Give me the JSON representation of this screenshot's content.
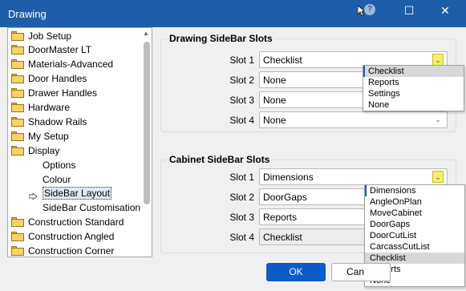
{
  "window": {
    "title": "Drawing",
    "help_glyph": "?",
    "maximize_glyph": "☐",
    "close_glyph": "✕"
  },
  "tree": {
    "items": [
      {
        "label": "Job Setup",
        "folder": true
      },
      {
        "label": "DoorMaster LT",
        "folder": true
      },
      {
        "label": "Materials-Advanced",
        "folder": true
      },
      {
        "label": "Door Handles",
        "folder": true
      },
      {
        "label": "Drawer Handles",
        "folder": true
      },
      {
        "label": "Hardware",
        "folder": true
      },
      {
        "label": "Shadow Rails",
        "folder": true
      },
      {
        "label": "My Setup",
        "folder": true
      },
      {
        "label": "Display",
        "folder": true
      },
      {
        "label": "Options",
        "folder": false
      },
      {
        "label": "Colour",
        "folder": false
      },
      {
        "label": "SideBar Layout",
        "folder": false,
        "selected": true
      },
      {
        "label": "SideBar Customisation",
        "folder": false
      },
      {
        "label": "Construction Standard",
        "folder": true
      },
      {
        "label": "Construction Angled",
        "folder": true
      },
      {
        "label": "Construction Corner",
        "folder": true
      }
    ]
  },
  "drawing_group": {
    "title": "Drawing SideBar Slots",
    "slots": [
      {
        "label": "Slot 1",
        "value": "Checklist"
      },
      {
        "label": "Slot 2",
        "value": "None"
      },
      {
        "label": "Slot 3",
        "value": "None"
      },
      {
        "label": "Slot 4",
        "value": "None"
      }
    ],
    "dropdown": [
      "Checklist",
      "Reports",
      "Settings",
      "None"
    ]
  },
  "cabinet_group": {
    "title": "Cabinet SideBar Slots",
    "slots": [
      {
        "label": "Slot 1",
        "value": "Dimensions"
      },
      {
        "label": "Slot 2",
        "value": "DoorGaps"
      },
      {
        "label": "Slot 3",
        "value": "Reports"
      },
      {
        "label": "Slot 4",
        "value": "Checklist"
      }
    ],
    "dropdown": [
      "Dimensions",
      "AngleOnPlan",
      "MoveCabinet",
      "DoorGaps",
      "DoorCutList",
      "CarcassCutList",
      "Checklist",
      "Reports",
      "None"
    ]
  },
  "buttons": {
    "ok": "OK",
    "cancel": "Can"
  },
  "colors": {
    "titlebar": "#1e5ea8",
    "ok_button": "#0b5cc6",
    "dropdown_arrow_highlight": "#f5f06a"
  }
}
